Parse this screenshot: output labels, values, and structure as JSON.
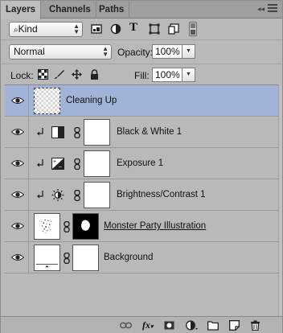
{
  "tabs": [
    {
      "label": "Layers",
      "active": true
    },
    {
      "label": "Channels",
      "active": false
    },
    {
      "label": "Paths",
      "active": false
    }
  ],
  "filter": {
    "kind_label": "Kind",
    "icons": [
      "pixel-filter-icon",
      "adjustment-filter-icon",
      "type-filter-icon",
      "shape-filter-icon",
      "smart-object-filter-icon",
      "filter-toggle-icon"
    ]
  },
  "blend": {
    "mode": "Normal",
    "opacity_label": "Opacity:",
    "opacity_value": "100%"
  },
  "lock": {
    "label": "Lock:",
    "fill_label": "Fill:",
    "fill_value": "100%"
  },
  "layers": [
    {
      "name": "Cleaning Up",
      "type": "pixel",
      "selected": true
    },
    {
      "name": "Black & White 1",
      "type": "adjustment",
      "icon": "black-white-icon",
      "clipped": true
    },
    {
      "name": "Exposure 1",
      "type": "adjustment",
      "icon": "exposure-icon",
      "clipped": true
    },
    {
      "name": "Brightness/Contrast 1",
      "type": "adjustment",
      "icon": "brightness-contrast-icon",
      "clipped": true
    },
    {
      "name": "Monster Party Illustration",
      "type": "masked",
      "underline": true
    },
    {
      "name": "Background",
      "type": "masked"
    }
  ],
  "bottom_icons": [
    "link-layers-icon",
    "fx-icon",
    "add-mask-icon",
    "adjustment-layer-icon",
    "new-group-icon",
    "new-layer-icon",
    "trash-icon"
  ],
  "colors": {
    "panel_bg": "#b9b9b9",
    "selected_row": "#a2b3d8",
    "tab_bar": "#9f9f9f"
  }
}
